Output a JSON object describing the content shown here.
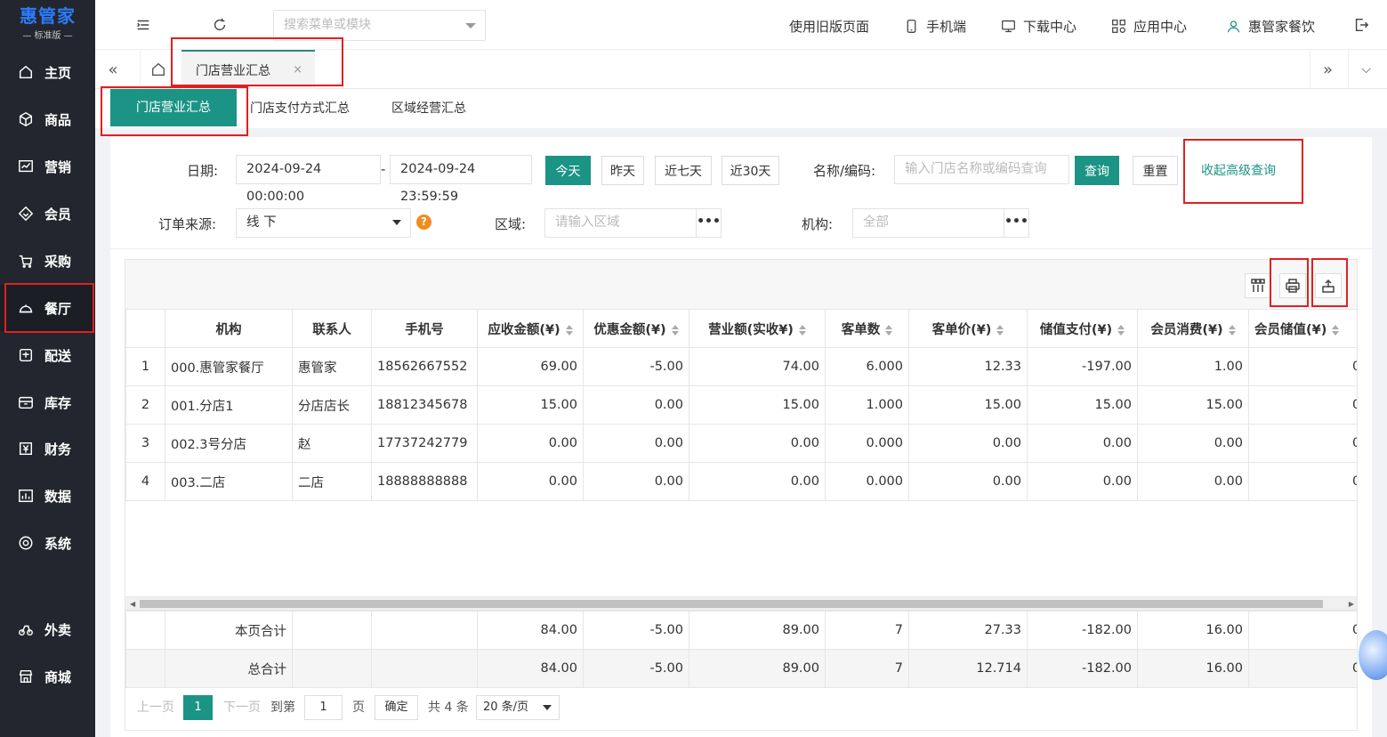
{
  "brand": {
    "title": "惠管家",
    "subtitle": "— 标准版 —",
    "accent": "#2b7cff"
  },
  "sidebar": {
    "items": [
      {
        "label": "主页",
        "icon": "home-icon"
      },
      {
        "label": "商品",
        "icon": "cube-icon"
      },
      {
        "label": "营销",
        "icon": "chart-icon"
      },
      {
        "label": "会员",
        "icon": "diamond-icon"
      },
      {
        "label": "采购",
        "icon": "cart-icon"
      },
      {
        "label": "餐厅",
        "icon": "cloche-icon",
        "active": true
      },
      {
        "label": "配送",
        "icon": "truck-icon"
      },
      {
        "label": "库存",
        "icon": "box-icon"
      },
      {
        "label": "财务",
        "icon": "yen-icon"
      },
      {
        "label": "数据",
        "icon": "bar-chart-icon"
      },
      {
        "label": "系统",
        "icon": "target-icon"
      },
      {
        "label": "外卖",
        "icon": "scooter-icon"
      },
      {
        "label": "商城",
        "icon": "shop-icon"
      }
    ]
  },
  "topbar": {
    "search_placeholder": "搜索菜单或模块",
    "old_page": "使用旧版页面",
    "mobile": "手机端",
    "download": "下载中心",
    "apps": "应用中心",
    "user": "惠管家餐饮"
  },
  "tabs": {
    "open_tab": "门店营业汇总",
    "close": "×"
  },
  "subtabs": [
    "门店营业汇总",
    "门店支付方式汇总",
    "区域经营汇总"
  ],
  "filters": {
    "date_label": "日期:",
    "date_start": "2024-09-24 00:00:00",
    "date_sep": "-",
    "date_end": "2024-09-24 23:59:59",
    "quick": [
      "今天",
      "昨天",
      "近七天",
      "近30天"
    ],
    "name_label": "名称/编码:",
    "name_placeholder": "输入门店名称或编码查询",
    "query": "查询",
    "reset": "重置",
    "collapse": "收起高级查询",
    "source_label": "订单来源:",
    "source_value": "线 下",
    "help": "?",
    "region_label": "区域:",
    "region_placeholder": "请输入区域",
    "org_label": "机构:",
    "org_placeholder": "全部",
    "more": "•••"
  },
  "table": {
    "headers": [
      "机构",
      "联系人",
      "手机号",
      "应收金额(¥)",
      "优惠金额(¥)",
      "营业额(实收¥)",
      "客单数",
      "客单价(¥)",
      "储值支付(¥)",
      "会员消费(¥)",
      "会员储值(¥)"
    ],
    "rows": [
      {
        "idx": "1",
        "org": "000.惠管家餐厅",
        "contact": "惠管家",
        "phone": "18562667552",
        "receivable": "69.00",
        "discount": "-5.00",
        "revenue": "74.00",
        "orders": "6.000",
        "avg": "12.33",
        "stored_pay": "-197.00",
        "member_spend": "1.00",
        "member_store": "0."
      },
      {
        "idx": "2",
        "org": "001.分店1",
        "contact": "分店店长",
        "phone": "18812345678",
        "receivable": "15.00",
        "discount": "0.00",
        "revenue": "15.00",
        "orders": "1.000",
        "avg": "15.00",
        "stored_pay": "15.00",
        "member_spend": "15.00",
        "member_store": "0."
      },
      {
        "idx": "3",
        "org": "002.3号分店",
        "contact": "赵",
        "phone": "17737242779",
        "receivable": "0.00",
        "discount": "0.00",
        "revenue": "0.00",
        "orders": "0.000",
        "avg": "0.00",
        "stored_pay": "0.00",
        "member_spend": "0.00",
        "member_store": "0."
      },
      {
        "idx": "4",
        "org": "003.二店",
        "contact": "二店",
        "phone": "18888888888",
        "receivable": "0.00",
        "discount": "0.00",
        "revenue": "0.00",
        "orders": "0.000",
        "avg": "0.00",
        "stored_pay": "0.00",
        "member_spend": "0.00",
        "member_store": "0."
      }
    ],
    "page_total": {
      "label": "本页合计",
      "receivable": "84.00",
      "discount": "-5.00",
      "revenue": "89.00",
      "orders": "7",
      "avg": "27.33",
      "stored_pay": "-182.00",
      "member_spend": "16.00",
      "member_store": "0."
    },
    "grand_total": {
      "label": "总合计",
      "receivable": "84.00",
      "discount": "-5.00",
      "revenue": "89.00",
      "orders": "7",
      "avg": "12.714",
      "stored_pay": "-182.00",
      "member_spend": "16.00",
      "member_store": "0."
    }
  },
  "pager": {
    "prev": "上一页",
    "current": "1",
    "next": "下一页",
    "goto": "到第",
    "page_input": "1",
    "page_unit": "页",
    "confirm": "确定",
    "total": "共 4 条",
    "page_size": "20 条/页"
  },
  "colors": {
    "primary": "#1b9485",
    "highlight_border": "#e02020",
    "sidebar_bg": "#23262e"
  }
}
